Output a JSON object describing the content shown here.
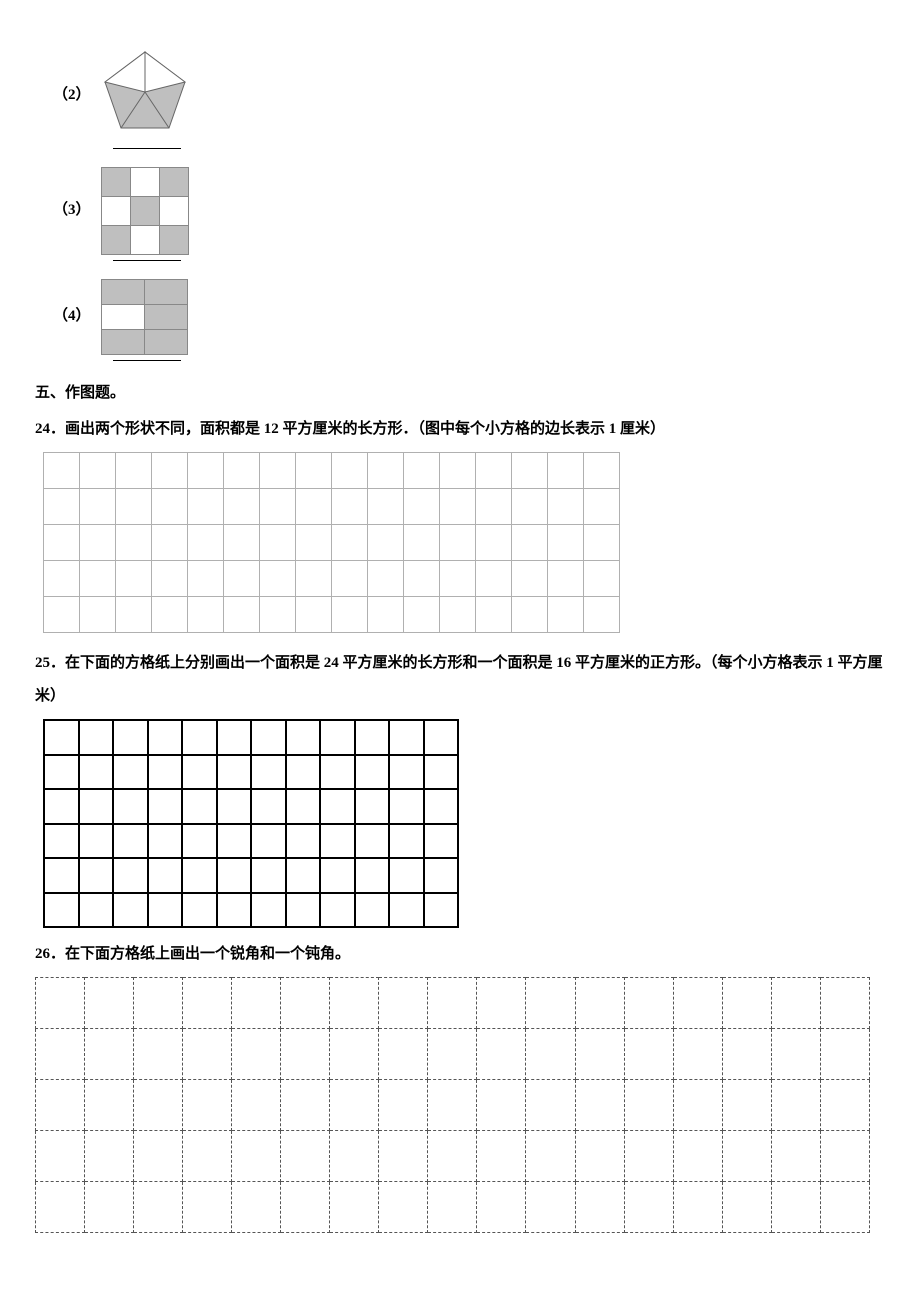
{
  "items": {
    "i2": {
      "label": "（2）"
    },
    "i3": {
      "label": "（3）"
    },
    "i4": {
      "label": "（4）"
    }
  },
  "section5": {
    "title": "五、作图题。"
  },
  "q24": {
    "text": "24．画出两个形状不同，面积都是 12 平方厘米的长方形．（图中每个小方格的边长表示 1 厘米）"
  },
  "q25": {
    "text": "25．在下面的方格纸上分别画出一个面积是 24 平方厘米的长方形和一个面积是 16 平方厘米的正方形。（每个小方格表示 1 平方厘米）"
  },
  "q26": {
    "text": "26．在下面方格纸上画出一个锐角和一个钝角。"
  },
  "grid1": {
    "rows": 5,
    "cols": 16
  },
  "grid2": {
    "rows": 6,
    "cols": 12
  },
  "grid3": {
    "rows": 5,
    "cols": 17
  },
  "checker3": {
    "cells": [
      [
        "g",
        "w",
        "g"
      ],
      [
        "w",
        "g",
        "w"
      ],
      [
        "g",
        "w",
        "g"
      ]
    ]
  },
  "striped": {
    "cells": [
      [
        "g",
        "g"
      ],
      [
        "w",
        "g"
      ],
      [
        "g",
        "g"
      ]
    ]
  }
}
